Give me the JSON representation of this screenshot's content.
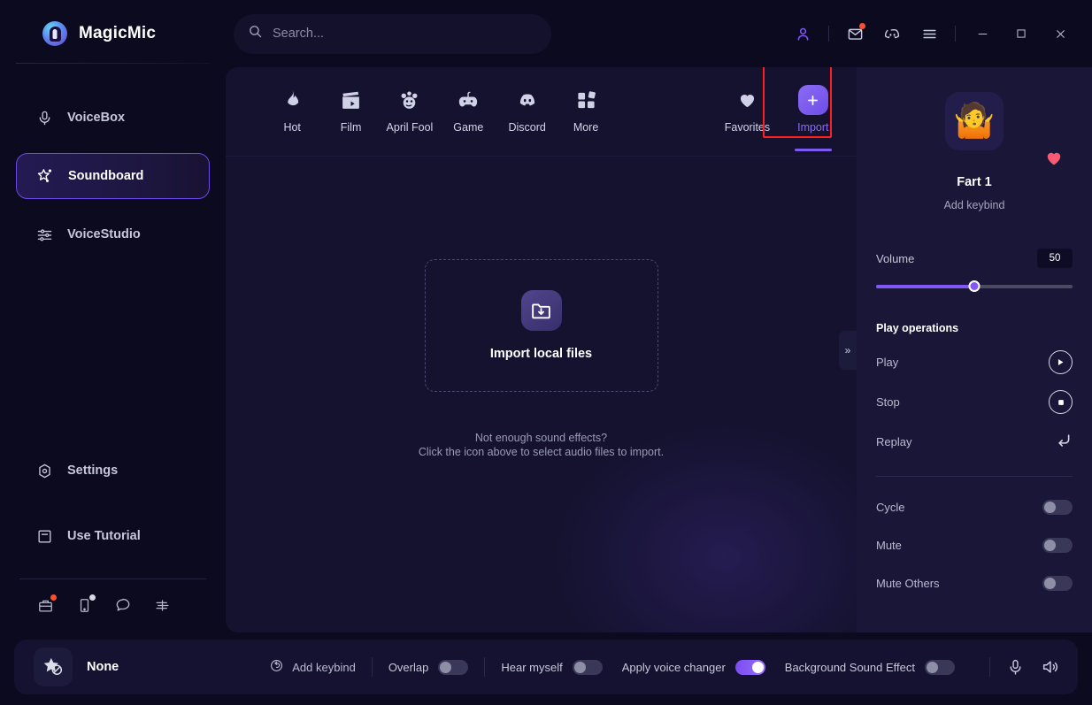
{
  "app": {
    "name": "MagicMic"
  },
  "search": {
    "placeholder": "Search..."
  },
  "titlebar": {
    "icons": [
      "account-icon",
      "mail-icon",
      "discord-icon",
      "menu-icon"
    ],
    "minimize": "—",
    "maximize": "□",
    "close": "✕"
  },
  "sidebar": {
    "items": [
      {
        "label": "VoiceBox",
        "icon": "microphone-icon",
        "active": false
      },
      {
        "label": "Soundboard",
        "icon": "sparkle-star-icon",
        "active": true
      },
      {
        "label": "VoiceStudio",
        "icon": "sliders-icon",
        "active": false
      }
    ],
    "bottom_items": [
      {
        "label": "Settings",
        "icon": "gear-icon"
      },
      {
        "label": "Use Tutorial",
        "icon": "book-icon"
      }
    ],
    "mini_icons": [
      {
        "name": "store-icon",
        "badge": true
      },
      {
        "name": "mobile-icon",
        "badge": true
      },
      {
        "name": "chat-icon",
        "badge": false
      },
      {
        "name": "feedback-icon",
        "badge": false
      }
    ]
  },
  "categories": [
    {
      "label": "Hot",
      "icon": "flame-icon"
    },
    {
      "label": "Film",
      "icon": "clapperboard-icon"
    },
    {
      "label": "April Fool",
      "icon": "clown-icon"
    },
    {
      "label": "Game",
      "icon": "gamepad-icon"
    },
    {
      "label": "Discord",
      "icon": "discord-icon"
    },
    {
      "label": "More",
      "icon": "grid-icon"
    },
    {
      "label": "Favorites",
      "icon": "heart-icon"
    },
    {
      "label": "Import",
      "icon": "plus-icon",
      "active": true,
      "highlighted": true
    }
  ],
  "main": {
    "drop_title": "Import local files",
    "drop_icon": "folder-download-icon",
    "hint_line1": "Not enough sound effects?",
    "hint_line2": "Click the icon above to select audio files to import.",
    "collapse_icon": "»"
  },
  "details": {
    "favorite_icon": "heart-filled-icon",
    "avatar": "🤷",
    "name": "Fart 1",
    "keybind": "Add keybind",
    "volume_label": "Volume",
    "volume_value": "50",
    "volume_percent": 50,
    "play_operations_title": "Play operations",
    "operations": [
      {
        "label": "Play",
        "icon": "play-icon"
      },
      {
        "label": "Stop",
        "icon": "stop-icon"
      },
      {
        "label": "Replay",
        "icon": "replay-icon"
      }
    ],
    "toggles": [
      {
        "label": "Cycle",
        "on": false
      },
      {
        "label": "Mute",
        "on": false
      },
      {
        "label": "Mute Others",
        "on": false
      }
    ]
  },
  "bottombar": {
    "current_name": "None",
    "current_icon": "star-none-icon",
    "add_keybind": "Add keybind",
    "overlap_label": "Overlap",
    "overlap_on": false,
    "hear_myself_label": "Hear myself",
    "hear_myself_on": false,
    "apply_voice_changer_label": "Apply voice changer",
    "apply_voice_changer_on": true,
    "background_sound_label": "Background Sound Effect",
    "background_sound_on": false,
    "mic_icon": "microphone-icon",
    "speaker_icon": "speaker-icon"
  },
  "colors": {
    "accent": "#8257f5",
    "highlight_box": "#ff1f1f",
    "favorite": "#fb5a72",
    "badge": "#ff4d2d",
    "bg": "#0b0a1e",
    "panel": "#191637",
    "center": "#14122e"
  }
}
